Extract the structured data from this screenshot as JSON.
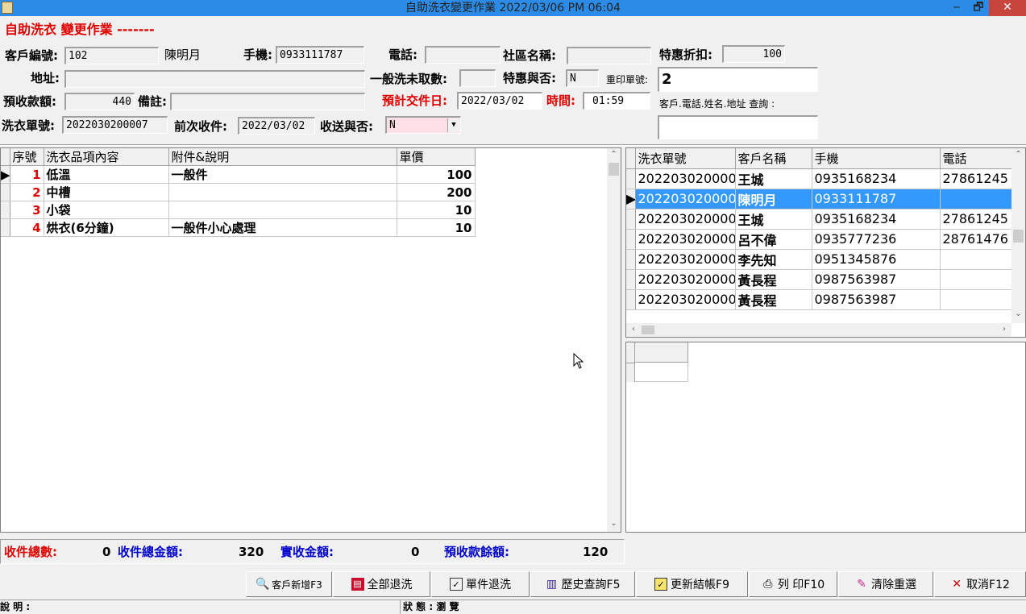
{
  "window": {
    "title": "自助洗衣變更作業   2022/03/06 PM 06:04",
    "minimize": "‒",
    "maximize": "🗗",
    "close": "✕"
  },
  "header": {
    "heading": "自助洗衣  變更作業  -------"
  },
  "form": {
    "customer_no_label": "客戶編號:",
    "customer_no": "102",
    "customer_name": "陳明月",
    "mobile_label": "手機:",
    "mobile": "0933111787",
    "phone_label": "電話:",
    "phone": "",
    "community_label": "社區名稱:",
    "community": "",
    "discount_label": "特惠折扣:",
    "discount": "100",
    "address_label": "地址:",
    "address": "",
    "untaken_label": "一般洗未取數:",
    "untaken": "",
    "special_label": "特惠與否:",
    "special": "N",
    "reprint_label": "重印單號:",
    "reprint": "2",
    "prepaid_label": "預收款額:",
    "prepaid": "440",
    "note_label": "備註:",
    "note": "",
    "due_date_label": "預計交件日:",
    "due_date": "2022/03/02",
    "time_label": "時間:",
    "time": "01:59",
    "query_label": "客戶.電話.姓名.地址 查詢 :",
    "query": "",
    "order_no_label": "洗衣單號:",
    "order_no": "2022030200007",
    "prev_label": "前次收件:",
    "prev": "2022/03/02",
    "delivery_label": "收送與否:",
    "delivery": "N"
  },
  "items_grid": {
    "columns": [
      "序號",
      "洗衣品項內容",
      "附件&說明",
      "單價"
    ],
    "rows": [
      {
        "no": "1",
        "item": "低溫",
        "note": "一般件",
        "price": "100"
      },
      {
        "no": "2",
        "item": "中槽",
        "note": "",
        "price": "200"
      },
      {
        "no": "3",
        "item": "小袋",
        "note": "",
        "price": "10"
      },
      {
        "no": "4",
        "item": "烘衣(6分鐘)",
        "note": "一般件小心處理",
        "price": "10"
      }
    ]
  },
  "orders_grid": {
    "columns": [
      "洗衣單號",
      "客戶名稱",
      "手機",
      "電話"
    ],
    "rows": [
      {
        "order": "202203020000",
        "name": "王城",
        "mobile": "0935168234",
        "phone": "27861245"
      },
      {
        "order": "202203020000",
        "name": "陳明月",
        "mobile": "0933111787",
        "phone": ""
      },
      {
        "order": "202203020000",
        "name": "王城",
        "mobile": "0935168234",
        "phone": "27861245"
      },
      {
        "order": "202203020000",
        "name": "呂不偉",
        "mobile": "0935777236",
        "phone": "28761476"
      },
      {
        "order": "202203020000",
        "name": "李先知",
        "mobile": "0951345876",
        "phone": ""
      },
      {
        "order": "202203020000",
        "name": "黃長程",
        "mobile": "0987563987",
        "phone": ""
      },
      {
        "order": "202203020000",
        "name": "黃長程",
        "mobile": "0987563987",
        "phone": ""
      }
    ],
    "selected_index": 1
  },
  "totals": {
    "count_label": "收件總數:",
    "count": "0",
    "amount_label": "收件總金額:",
    "amount": "320",
    "paid_label": "實收金額:",
    "paid": "0",
    "balance_label": "預收款餘額:",
    "balance": "120"
  },
  "buttons": {
    "add_customer": "客戶新增F3",
    "return_all": "全部退洗",
    "return_single": "單件退洗",
    "history": "歷史查詢F5",
    "update_settle": "更新結帳F9",
    "print": "列  印F10",
    "clear": "清除重選",
    "cancel": "取消F12"
  },
  "status": {
    "desc_label": "說 明 :",
    "state_label": "狀 態 : 瀏 覽"
  },
  "colors": {
    "titlebar": "#2b8be6",
    "selection": "#3399ff",
    "label_red": "#e00000",
    "label_blue": "#0000cc",
    "delivery_bg": "#ffe0e6"
  },
  "icons": [
    "app-icon",
    "magnifier-icon",
    "red-book-icon",
    "checklist-icon",
    "building-icon",
    "checkbook-icon",
    "printer-icon",
    "eraser-icon",
    "red-x-icon"
  ]
}
